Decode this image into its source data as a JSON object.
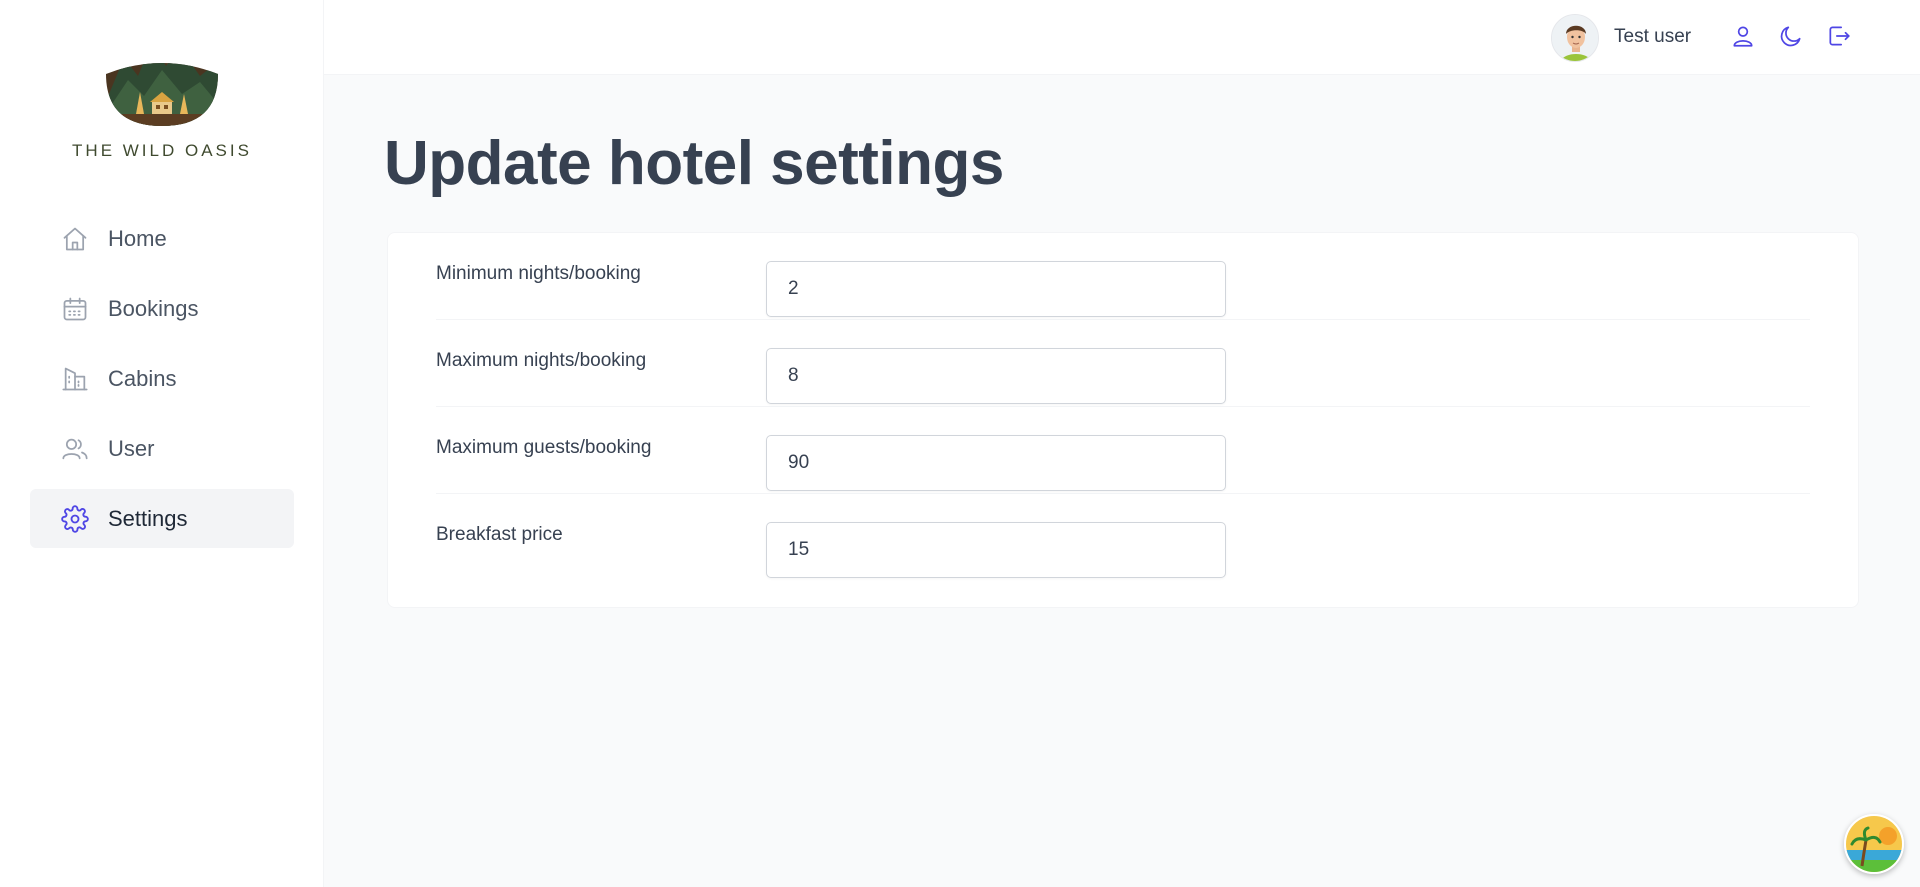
{
  "brand": {
    "name": "THE WILD OASIS"
  },
  "sidebar": {
    "items": [
      {
        "label": "Home",
        "icon": "home-icon",
        "active": false
      },
      {
        "label": "Bookings",
        "icon": "calendar-icon",
        "active": false
      },
      {
        "label": "Cabins",
        "icon": "building-icon",
        "active": false
      },
      {
        "label": "User",
        "icon": "users-icon",
        "active": false
      },
      {
        "label": "Settings",
        "icon": "gear-icon",
        "active": true
      }
    ]
  },
  "header": {
    "user_name": "Test user",
    "buttons": [
      "user-icon",
      "moon-icon",
      "logout-icon"
    ]
  },
  "main": {
    "title": "Update hotel settings",
    "fields": [
      {
        "label": "Minimum nights/booking",
        "value": "2"
      },
      {
        "label": "Maximum nights/booking",
        "value": "8"
      },
      {
        "label": "Maximum guests/booking",
        "value": "90"
      },
      {
        "label": "Breakfast price",
        "value": "15"
      }
    ]
  },
  "colors": {
    "accent": "#4f46e5",
    "title": "#374151",
    "background": "#f9fafb"
  }
}
